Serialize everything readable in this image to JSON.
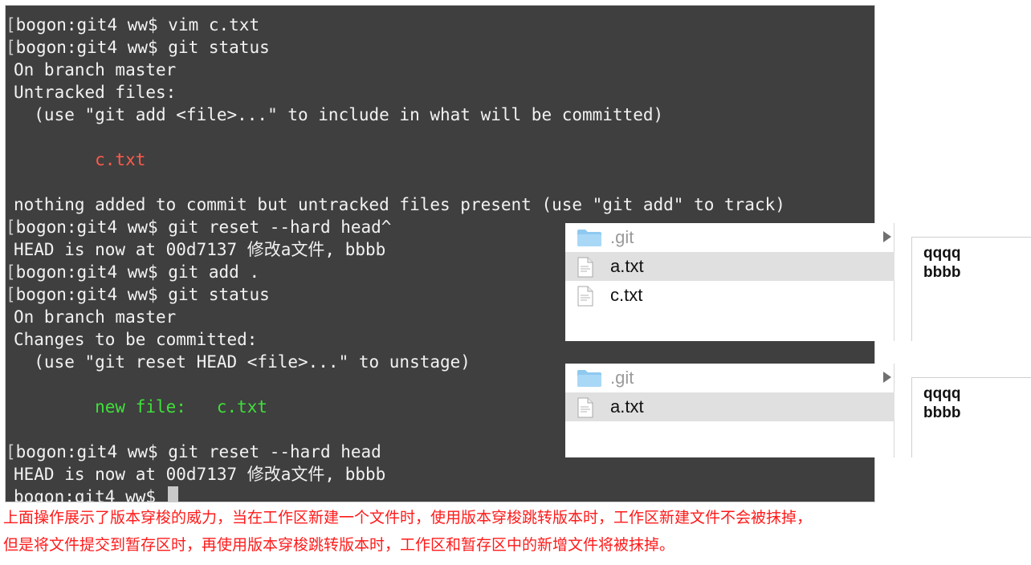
{
  "terminal": {
    "prompt": "bogon:git4 ww$",
    "lines": [
      {
        "bracket": "[",
        "text": "bogon:git4 ww$ vim c.txt"
      },
      {
        "bracket": "[",
        "text": "bogon:git4 ww$ git status"
      },
      {
        "text": "On branch master"
      },
      {
        "text": "Untracked files:"
      },
      {
        "text": "  (use \"git add <file>...\" to include in what will be committed)"
      },
      {
        "text": ""
      },
      {
        "text": "        c.txt",
        "color": "red"
      },
      {
        "text": ""
      },
      {
        "text": "nothing added to commit but untracked files present (use \"git add\" to track)"
      },
      {
        "bracket": "[",
        "text": "bogon:git4 ww$ git reset --hard head^"
      },
      {
        "text": "HEAD is now at 00d7137 修改a文件, bbbb"
      },
      {
        "bracket": "[",
        "text": "bogon:git4 ww$ git add ."
      },
      {
        "bracket": "[",
        "text": "bogon:git4 ww$ git status"
      },
      {
        "text": "On branch master"
      },
      {
        "text": "Changes to be committed:"
      },
      {
        "text": "  (use \"git reset HEAD <file>...\" to unstage)"
      },
      {
        "text": ""
      },
      {
        "text": "        new file:   c.txt",
        "color": "green"
      },
      {
        "text": ""
      },
      {
        "bracket": "[",
        "text": "bogon:git4 ww$ git reset --hard head"
      },
      {
        "text": "HEAD is now at 00d7137 修改a文件, bbbb"
      },
      {
        "text": "bogon:git4 ww$ ",
        "cursor": true
      }
    ]
  },
  "finder_top": {
    "items": [
      {
        "name": ".git",
        "type": "folder",
        "selected": false,
        "has_arrow": true
      },
      {
        "name": "a.txt",
        "type": "file",
        "selected": true
      },
      {
        "name": "c.txt",
        "type": "file",
        "selected": false
      }
    ],
    "preview": [
      "qqqq",
      "bbbb"
    ]
  },
  "finder_bottom": {
    "items": [
      {
        "name": ".git",
        "type": "folder",
        "selected": false,
        "has_arrow": true
      },
      {
        "name": "a.txt",
        "type": "file",
        "selected": true
      }
    ],
    "preview": [
      "qqqq",
      "bbbb"
    ]
  },
  "caption": {
    "line1": "上面操作展示了版本穿梭的威力，当在工作区新建一个文件时，使用版本穿梭跳转版本时，工作区新建文件不会被抹掉，",
    "line2": "但是将文件提交到暂存区时，再使用版本穿梭跳转版本时，工作区和暂存区中的新增文件将被抹掉。"
  },
  "colors": {
    "terminal_bg": "#3f3f3f",
    "terminal_text": "#f2f2f2",
    "untracked": "#ff5a4a",
    "staged": "#3fe03a",
    "caption": "#ff1a1a",
    "folder_icon": "#8fc9f0"
  },
  "icons": {
    "folder": "folder-icon",
    "file": "document-icon",
    "expand": "disclosure-arrow-icon"
  }
}
